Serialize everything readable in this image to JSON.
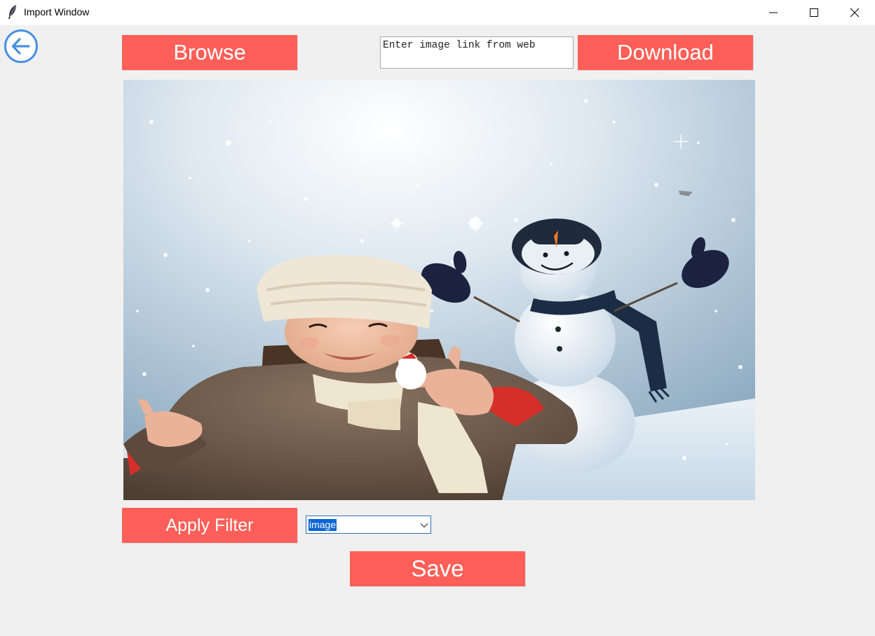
{
  "window": {
    "title": "Import Window",
    "icon": "feather-icon",
    "controls": [
      "minimize-icon",
      "maximize-icon",
      "close-icon"
    ]
  },
  "nav": {
    "back_icon": "back-arrow-icon",
    "accent_color": "#4a90e2"
  },
  "toolbar": {
    "browse_label": "Browse",
    "download_label": "Download",
    "url_placeholder": "Enter image link from web",
    "url_value": ""
  },
  "preview": {
    "image_description_icon": "image-preview"
  },
  "filter": {
    "apply_label": "Apply Filter",
    "selected_option": "image"
  },
  "actions": {
    "save_label": "Save"
  },
  "colors": {
    "button_bg": "#ff5f58",
    "button_text": "#ffffff",
    "window_bg": "#f0f0f0",
    "selection_bg": "#0a64d8"
  }
}
